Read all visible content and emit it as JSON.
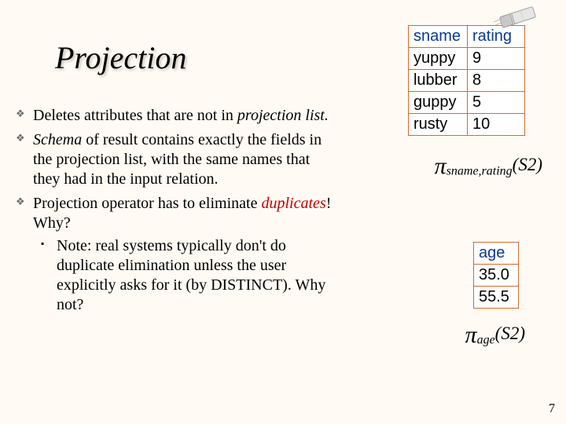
{
  "title": "Projection",
  "bullets": {
    "b1a": "Deletes attributes that are not in ",
    "b1b_i": "projection list.",
    "b2a_i": "Schema",
    "b2b": " of result contains exactly the fields in the projection list, with the same names that they had in the input relation.",
    "b3a": "Projection operator has to eliminate ",
    "b3b_dup": "duplicates",
    "b3c": "! Why?",
    "b3_note": "Note: real systems typically don't do duplicate elimination unless the user explicitly asks for it (by DISTINCT). Why not?"
  },
  "table1": {
    "headers": {
      "c0": "sname",
      "c1": "rating"
    },
    "rows": [
      {
        "c0": "yuppy",
        "c1": "9"
      },
      {
        "c0": "lubber",
        "c1": "8"
      },
      {
        "c0": "guppy",
        "c1": "5"
      },
      {
        "c0": "rusty",
        "c1": "10"
      }
    ]
  },
  "table2": {
    "headers": {
      "c0": "age"
    },
    "rows": [
      {
        "c0": "35.0"
      },
      {
        "c0": "55.5"
      }
    ]
  },
  "formula1": {
    "sub": "sname,rating",
    "arg": "(S2)"
  },
  "formula2": {
    "sub": "age",
    "arg": "(S2)"
  },
  "pagenum": "7"
}
